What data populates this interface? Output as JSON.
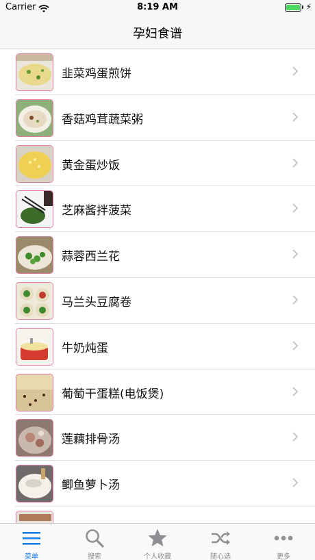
{
  "status_bar": {
    "carrier": "Carrier",
    "time": "8:19 AM"
  },
  "nav": {
    "title": "孕妇食谱"
  },
  "recipes": [
    {
      "title": "韭菜鸡蛋煎饼"
    },
    {
      "title": "香菇鸡茸蔬菜粥"
    },
    {
      "title": "黄金蛋炒饭"
    },
    {
      "title": "芝麻酱拌菠菜"
    },
    {
      "title": "蒜蓉西兰花"
    },
    {
      "title": "马兰头豆腐卷"
    },
    {
      "title": "牛奶炖蛋"
    },
    {
      "title": "葡萄干蛋糕(电饭煲)"
    },
    {
      "title": "莲藕排骨汤"
    },
    {
      "title": "鲫鱼萝卜汤"
    },
    {
      "title": ""
    }
  ],
  "tabs": [
    {
      "label": "菜单",
      "icon": "menu-list-icon",
      "active": true
    },
    {
      "label": "搜索",
      "icon": "search-icon",
      "active": false
    },
    {
      "label": "个人收藏",
      "icon": "star-icon",
      "active": false
    },
    {
      "label": "随心选",
      "icon": "shuffle-icon",
      "active": false
    },
    {
      "label": "更多",
      "icon": "more-dots-icon",
      "active": false
    }
  ],
  "colors": {
    "accent": "#1a7ff0",
    "inactive": "#8e8e93",
    "thumb_border": "#e07aa0",
    "battery": "#4cd964"
  }
}
